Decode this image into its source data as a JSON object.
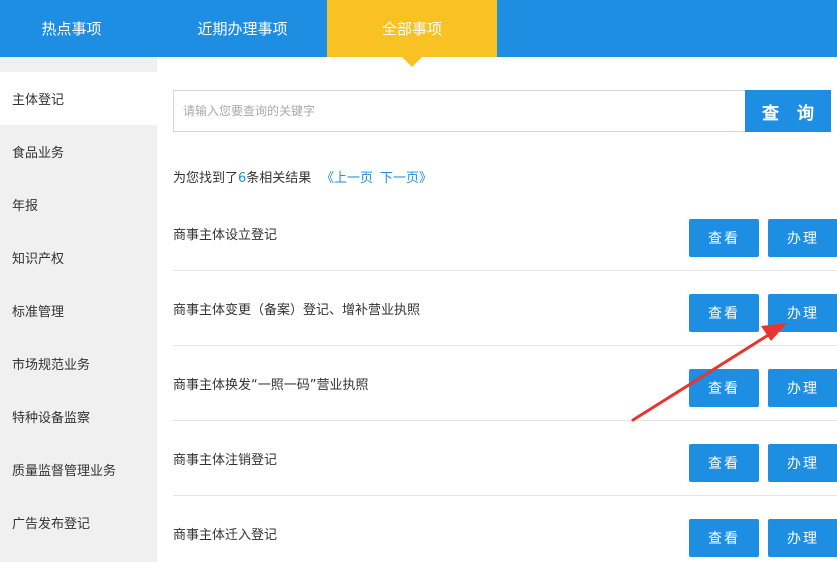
{
  "tabs": [
    {
      "label": "热点事项"
    },
    {
      "label": "近期办理事项"
    },
    {
      "label": "全部事项"
    }
  ],
  "sidebar": {
    "items": [
      {
        "label": "主体登记"
      },
      {
        "label": "食品业务"
      },
      {
        "label": "年报"
      },
      {
        "label": "知识产权"
      },
      {
        "label": "标准管理"
      },
      {
        "label": "市场规范业务"
      },
      {
        "label": "特种设备监察"
      },
      {
        "label": "质量监督管理业务"
      },
      {
        "label": "广告发布登记"
      }
    ]
  },
  "search": {
    "placeholder": "请输入您要查询的关键字",
    "button_label": "查 询"
  },
  "results": {
    "prefix": "为您找到了",
    "count": "6",
    "suffix": "条相关结果",
    "prev_label": "《上一页",
    "next_label": "下一页》",
    "items": [
      {
        "title": "商事主体设立登记",
        "view_label": "查看",
        "handle_label": "办理"
      },
      {
        "title": "商事主体变更（备案）登记、增补营业执照",
        "view_label": "查看",
        "handle_label": "办理"
      },
      {
        "title": "商事主体换发“一照一码”营业执照",
        "view_label": "查看",
        "handle_label": "办理"
      },
      {
        "title": "商事主体注销登记",
        "view_label": "查看",
        "handle_label": "办理"
      },
      {
        "title": "商事主体迁入登记",
        "view_label": "查看",
        "handle_label": "办理"
      }
    ]
  },
  "colors": {
    "primary": "#1e8ee3",
    "active_tab": "#f9c224",
    "annotation_arrow": "#e8352f"
  }
}
